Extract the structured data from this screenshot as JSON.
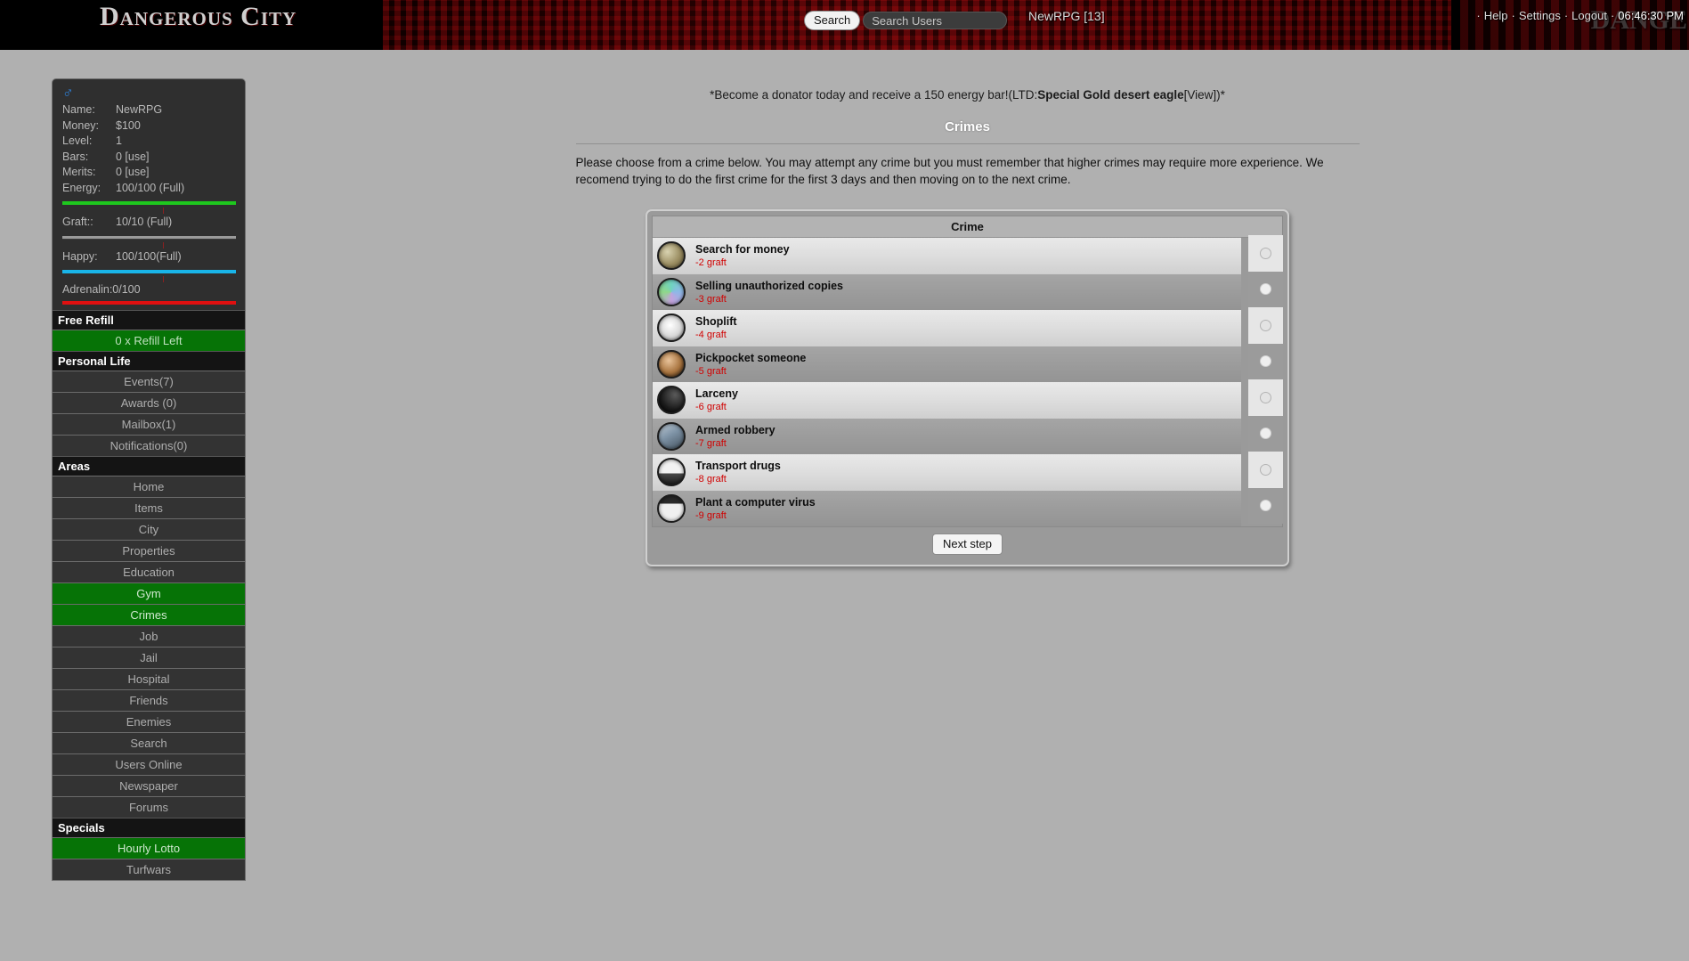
{
  "header": {
    "logo": "Dangerous City",
    "ghost_text": "DANGE",
    "search_button": "Search",
    "search_placeholder": "Search Users",
    "search_value": "",
    "user_tag": "NewRPG [13]",
    "nav": [
      {
        "label": "Help"
      },
      {
        "label": "Settings"
      },
      {
        "label": "Logout"
      }
    ],
    "clock": "06:46:30 PM",
    "bullet": "·"
  },
  "sidebar": {
    "gender_icon": "male-icon",
    "stats": [
      {
        "label": "Name:",
        "value": "NewRPG"
      },
      {
        "label": "Money:",
        "value": "$100"
      },
      {
        "label": "Level:",
        "value": "1"
      },
      {
        "label": "Bars:",
        "value": "0 [use]"
      },
      {
        "label": "Merits:",
        "value": "0 [use]"
      },
      {
        "label": "Energy:",
        "value": "100/100 (Full)"
      }
    ],
    "graft": {
      "label": "Graft::",
      "value": "10/10 (Full)"
    },
    "happy": {
      "label": "Happy:",
      "value": "100/100(Full)"
    },
    "adrenalin": "Adrenalin:0/100",
    "sections": [
      {
        "heading": "Free Refill",
        "items": [
          {
            "label": "0 x Refill Left",
            "highlight": true
          }
        ]
      },
      {
        "heading": "Personal Life",
        "items": [
          {
            "label": "Events(7)",
            "highlight": false
          },
          {
            "label": "Awards (0)",
            "highlight": false
          },
          {
            "label": "Mailbox(1)",
            "highlight": false
          },
          {
            "label": "Notifications(0)",
            "highlight": false
          }
        ]
      },
      {
        "heading": "Areas",
        "items": [
          {
            "label": "Home",
            "highlight": false
          },
          {
            "label": "Items",
            "highlight": false
          },
          {
            "label": "City",
            "highlight": false
          },
          {
            "label": "Properties",
            "highlight": false
          },
          {
            "label": "Education",
            "highlight": false
          },
          {
            "label": "Gym",
            "highlight": true
          },
          {
            "label": "Crimes",
            "highlight": true
          },
          {
            "label": "Job",
            "highlight": false
          },
          {
            "label": "Jail",
            "highlight": false
          },
          {
            "label": "Hospital",
            "highlight": false
          },
          {
            "label": "Friends",
            "highlight": false
          },
          {
            "label": "Enemies",
            "highlight": false
          },
          {
            "label": "Search",
            "highlight": false
          },
          {
            "label": "Users Online",
            "highlight": false
          },
          {
            "label": "Newspaper",
            "highlight": false
          },
          {
            "label": "Forums",
            "highlight": false
          }
        ]
      },
      {
        "heading": "Specials",
        "items": [
          {
            "label": "Hourly Lotto",
            "highlight": true
          },
          {
            "label": "Turfwars",
            "highlight": false
          }
        ]
      }
    ]
  },
  "main": {
    "donator_prefix": "*Become a donator today and receive a 150 energy bar!(LTD:",
    "donator_item": "Special Gold desert eagle",
    "donator_view": "[View])*",
    "page_title": "Crimes",
    "intro": "Please choose from a crime below. You may attempt any crime but you must remember that higher crimes may require more experience. We recomend trying to do the first crime for the first 3 days and then moving on to the next crime.",
    "table_header": "Crime",
    "next_step": "Next step",
    "crimes": [
      {
        "name": "Search for money",
        "graft": "-2 graft",
        "icon": "money-icon"
      },
      {
        "name": "Selling unauthorized copies",
        "graft": "-3 graft",
        "icon": "cd-icon"
      },
      {
        "name": "Shoplift",
        "graft": "-4 graft",
        "icon": "shop-icon"
      },
      {
        "name": "Pickpocket someone",
        "graft": "-5 graft",
        "icon": "hand-icon"
      },
      {
        "name": "Larceny",
        "graft": "-6 graft",
        "icon": "bag-icon"
      },
      {
        "name": "Armed robbery",
        "graft": "-7 graft",
        "icon": "gun-icon"
      },
      {
        "name": "Transport drugs",
        "graft": "-8 graft",
        "icon": "truck-icon"
      },
      {
        "name": "Plant a computer virus",
        "graft": "-9 graft",
        "icon": "virus-icon"
      }
    ]
  },
  "colors": {
    "energy_bar": "#1ec81e",
    "happy_bar": "#19b4e8",
    "adrenalin_bar": "#e01010",
    "graft_bar": "#9a9a9a",
    "highlight": "#067306",
    "graft_text": "#d00000"
  }
}
